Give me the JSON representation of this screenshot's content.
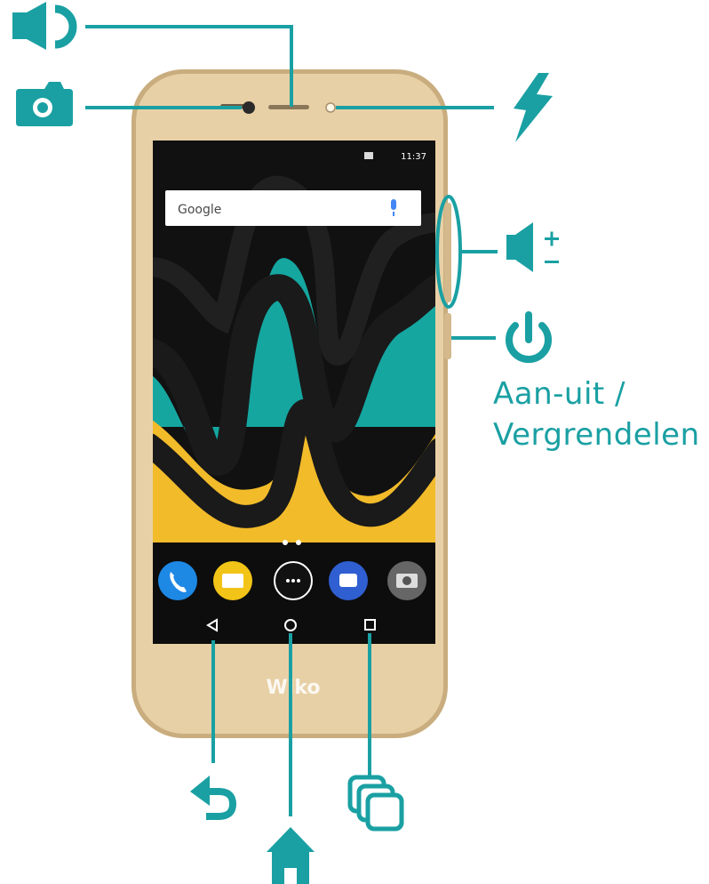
{
  "colors": {
    "accent": "#1aa0a3",
    "phone_body": "#e8d0a6",
    "phone_edge": "#c9ad7e",
    "screen": "#111111",
    "wallpaper_teal": "#15a6a0",
    "wallpaper_yellow": "#f2bb2a"
  },
  "phone": {
    "search_bar_text": "Google",
    "status_time": "11:37",
    "brand_logo": "Wiko"
  },
  "labels": {
    "power_line1": "Aan-uit /",
    "power_line2": "Vergrendelen"
  },
  "callouts": [
    {
      "name": "earpiece",
      "icon": "speaker-icon"
    },
    {
      "name": "front-camera",
      "icon": "camera-icon"
    },
    {
      "name": "front-flash",
      "icon": "lightning-icon"
    },
    {
      "name": "volume-keys",
      "icon": "volume-plus-minus-icon"
    },
    {
      "name": "power-key",
      "icon": "power-icon"
    },
    {
      "name": "back-key",
      "icon": "back-arrow-icon"
    },
    {
      "name": "home-key",
      "icon": "home-icon"
    },
    {
      "name": "recent-apps-key",
      "icon": "recent-apps-icon"
    }
  ],
  "dock_apps": [
    "phone-app-icon",
    "messages-app-icon",
    "app-drawer-icon",
    "messenger-app-icon",
    "camera-app-icon"
  ]
}
